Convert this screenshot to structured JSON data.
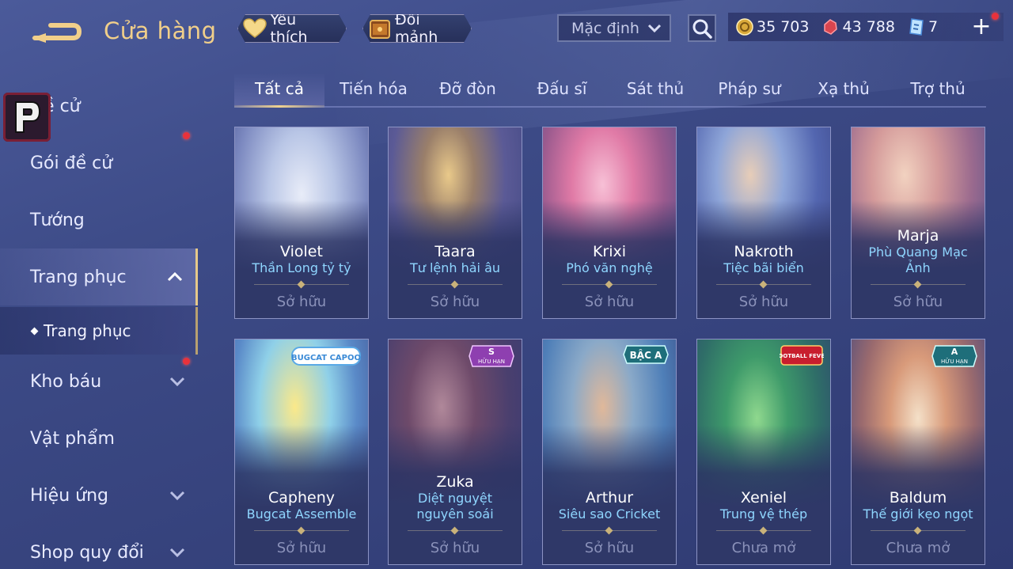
{
  "header": {
    "title": "Cửa hàng",
    "favorite_label": "Yêu thích",
    "exchange_label": "Đổi mảnh",
    "sort_value": "Mặc định"
  },
  "currencies": [
    {
      "icon": "gold-coin-icon",
      "value": "35 703"
    },
    {
      "icon": "red-gem-icon",
      "value": "43 788"
    },
    {
      "icon": "blue-voucher-icon",
      "value": "7"
    }
  ],
  "sidebar": {
    "items": [
      {
        "label": "Đề cử"
      },
      {
        "label": "Gói đề cử"
      },
      {
        "label": "Tướng"
      },
      {
        "label": "Trang phục"
      },
      {
        "label": "Kho báu"
      },
      {
        "label": "Vật phẩm"
      },
      {
        "label": "Hiệu ứng"
      },
      {
        "label": "Shop quy đổi"
      }
    ],
    "sub_item": "Trang phục"
  },
  "tabs": [
    "Tất cả",
    "Tiến hóa",
    "Đỡ đòn",
    "Đấu sĩ",
    "Sát thủ",
    "Pháp sư",
    "Xạ thủ",
    "Trợ thủ"
  ],
  "cards": [
    {
      "hero": "Violet",
      "skin": "Thần Long tỷ tỷ",
      "status": "Sở hữu"
    },
    {
      "hero": "Taara",
      "skin": "Tư lệnh hải âu",
      "status": "Sở hữu"
    },
    {
      "hero": "Krixi",
      "skin": "Phó văn nghệ",
      "status": "Sở hữu"
    },
    {
      "hero": "Nakroth",
      "skin": "Tiệc bãi biển",
      "status": "Sở hữu"
    },
    {
      "hero": "Marja",
      "skin": "Phù Quang Mạc Ảnh",
      "status": "Sở hữu"
    },
    {
      "hero": "Capheny",
      "skin": "Bugcat Assemble",
      "status": "Sở hữu",
      "badge": "BUGCAT CAPOO"
    },
    {
      "hero": "Zuka",
      "skin": "Diệt nguyệt nguyên soái",
      "status": "Sở hữu",
      "badge_tier": "S",
      "badge_sub": "HỮU HẠN"
    },
    {
      "hero": "Arthur",
      "skin": "Siêu sao Cricket",
      "status": "Sở hữu",
      "badge": "BẬC A"
    },
    {
      "hero": "Xeniel",
      "skin": "Trung vệ thép",
      "status": "Chưa mở",
      "badge": "FOOTBALL FEVER"
    },
    {
      "hero": "Baldum",
      "skin": "Thế giới kẹo ngọt",
      "status": "Chưa mở",
      "badge_tier": "A",
      "badge_sub": "HỮU HẠN"
    }
  ],
  "colors": {
    "accent_gold": "#f1cf8a",
    "skin_name": "#8fd6ff",
    "notification_red": "#e8323c"
  }
}
